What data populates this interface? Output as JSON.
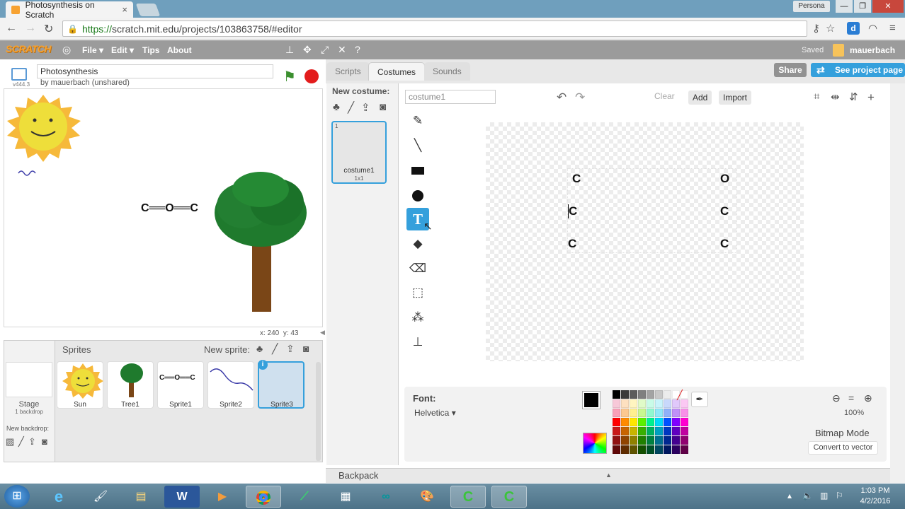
{
  "browser": {
    "tab_title": "Photosynthesis on Scratch",
    "tab_close": "×",
    "profile": "Persona",
    "url_scheme": "https://",
    "url_rest": "scratch.mit.edu/projects/103863758/#editor"
  },
  "scratch_menu": {
    "logo": "SCRATCH",
    "items": [
      "File ▾",
      "Edit ▾",
      "Tips",
      "About"
    ],
    "saved": "Saved",
    "user": "mauerbach"
  },
  "project": {
    "title": "Photosynthesis",
    "by": "by mauerbach (unshared)",
    "version": "v444.3",
    "mouse_x": "x: 240",
    "mouse_y": "y: 43",
    "stage_molecule": "C══O══C"
  },
  "sprites": {
    "heading": "Sprites",
    "new_sprite": "New sprite:",
    "stage_label": "Stage",
    "stage_sub": "1 backdrop",
    "new_backdrop": "New backdrop:",
    "items": [
      {
        "name": "Sun"
      },
      {
        "name": "Tree1"
      },
      {
        "name": "Sprite1"
      },
      {
        "name": "Sprite2"
      },
      {
        "name": "Sprite3"
      }
    ],
    "sprite1_thumb_text": "C══O══C"
  },
  "editor_tabs": {
    "scripts": "Scripts",
    "costumes": "Costumes",
    "sounds": "Sounds",
    "share": "Share",
    "see_project": "See project page"
  },
  "costumes": {
    "new_costume": "New costume:",
    "list": [
      {
        "num": "1",
        "name": "costume1",
        "size": "1x1"
      }
    ]
  },
  "paint": {
    "costume_name": "costume1",
    "clear": "Clear",
    "add": "Add",
    "import": "Import",
    "text_tool_glyph": "T",
    "canvas_letters": [
      "C",
      "O",
      "C",
      "C",
      "C",
      "C"
    ],
    "font_label": "Font:",
    "font_value": "Helvetica ▾",
    "zoom_level": "100%",
    "mode": "Bitmap Mode",
    "convert": "Convert to vector",
    "palette": [
      "#000000",
      "#3a3a3a",
      "#5c5c5c",
      "#7f7f7f",
      "#a3a3a3",
      "#c8c8c8",
      "#ececec",
      "#ffffff",
      "#ffffff",
      "#f7c8d8",
      "#fde0c0",
      "#fff5c0",
      "#e0fbc8",
      "#c8fbe8",
      "#c8f3fb",
      "#c8d8fb",
      "#e0c8fb",
      "#fbc8f3",
      "#f9a0b8",
      "#fcc890",
      "#fff090",
      "#c8f890",
      "#90f8d0",
      "#90e8f8",
      "#90b0f8",
      "#c090f8",
      "#f890e8",
      "#ff0000",
      "#ff8a00",
      "#ffe600",
      "#5cf000",
      "#00f090",
      "#00d8f8",
      "#0050ff",
      "#8000ff",
      "#ff00d0",
      "#c81818",
      "#c86400",
      "#c8b400",
      "#38b000",
      "#00b060",
      "#00a0c0",
      "#0038c0",
      "#6000c0",
      "#c000a0",
      "#901010",
      "#904400",
      "#908000",
      "#208000",
      "#008040",
      "#007090",
      "#002890",
      "#440090",
      "#900070",
      "#600808",
      "#602c00",
      "#605400",
      "#145000",
      "#005028",
      "#004860",
      "#001860",
      "#2c0060",
      "#600048"
    ]
  },
  "backpack": {
    "label": "Backpack"
  },
  "taskbar": {
    "time": "1:03 PM",
    "date": "4/2/2016"
  }
}
